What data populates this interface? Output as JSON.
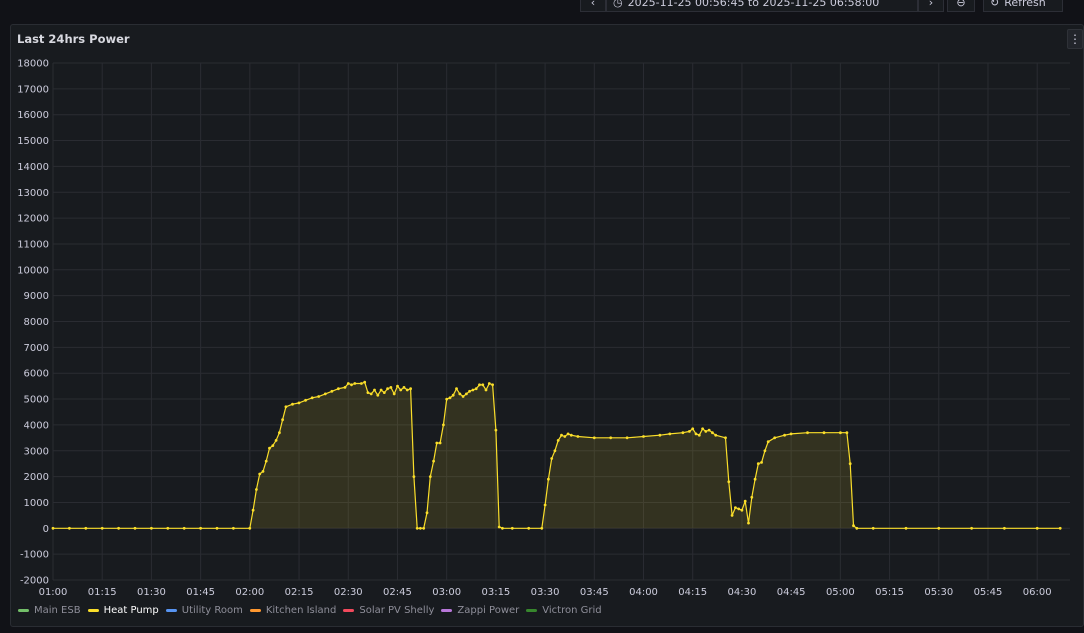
{
  "toolbar": {
    "back_icon": "chevron-left-icon",
    "time_range_text": "2025-11-25 00:56:45 to 2025-11-25 06:58:00",
    "forward_icon": "chevron-right-icon",
    "zoom_icon": "zoom-out-icon",
    "refresh_label": "Refresh"
  },
  "panel": {
    "title": "Last 24hrs Power",
    "menu_icon": "more-vertical-icon"
  },
  "chart_data": {
    "type": "line",
    "title": "Last 24hrs Power",
    "xlabel": "",
    "ylabel": "",
    "x_range": [
      "01:00",
      "06:10"
    ],
    "ylim": [
      -2000,
      18000
    ],
    "y_ticks": [
      18000,
      17000,
      16000,
      15000,
      14000,
      13000,
      12000,
      11000,
      10000,
      9000,
      8000,
      7000,
      6000,
      5000,
      4000,
      3000,
      2000,
      1000,
      0,
      -1000,
      -2000
    ],
    "x_ticks": [
      "01:00",
      "01:15",
      "01:30",
      "01:45",
      "02:00",
      "02:15",
      "02:30",
      "02:45",
      "03:00",
      "03:15",
      "03:30",
      "03:45",
      "04:00",
      "04:15",
      "04:30",
      "04:45",
      "05:00",
      "05:15",
      "05:30",
      "05:45",
      "06:00"
    ],
    "grid": true,
    "legend_position": "bottom-left",
    "series": [
      {
        "name": "Main ESB",
        "color": "#73bf69",
        "visible": false,
        "points": []
      },
      {
        "name": "Heat Pump",
        "color": "#fade2a",
        "visible": true,
        "points": [
          [
            "01:00",
            0
          ],
          [
            "01:05",
            0
          ],
          [
            "01:10",
            0
          ],
          [
            "01:15",
            0
          ],
          [
            "01:20",
            0
          ],
          [
            "01:25",
            0
          ],
          [
            "01:30",
            0
          ],
          [
            "01:35",
            0
          ],
          [
            "01:40",
            0
          ],
          [
            "01:45",
            0
          ],
          [
            "01:50",
            0
          ],
          [
            "01:55",
            0
          ],
          [
            "02:00",
            0
          ],
          [
            "02:01",
            700
          ],
          [
            "02:02",
            1500
          ],
          [
            "02:03",
            2100
          ],
          [
            "02:04",
            2200
          ],
          [
            "02:05",
            2600
          ],
          [
            "02:06",
            3100
          ],
          [
            "02:07",
            3200
          ],
          [
            "02:08",
            3400
          ],
          [
            "02:09",
            3700
          ],
          [
            "02:10",
            4200
          ],
          [
            "02:11",
            4700
          ],
          [
            "02:13",
            4800
          ],
          [
            "02:15",
            4850
          ],
          [
            "02:17",
            4950
          ],
          [
            "02:19",
            5050
          ],
          [
            "02:21",
            5100
          ],
          [
            "02:23",
            5200
          ],
          [
            "02:25",
            5300
          ],
          [
            "02:27",
            5400
          ],
          [
            "02:29",
            5450
          ],
          [
            "02:30",
            5600
          ],
          [
            "02:31",
            5550
          ],
          [
            "02:32",
            5600
          ],
          [
            "02:34",
            5600
          ],
          [
            "02:35",
            5650
          ],
          [
            "02:36",
            5250
          ],
          [
            "02:37",
            5200
          ],
          [
            "02:38",
            5350
          ],
          [
            "02:39",
            5150
          ],
          [
            "02:40",
            5350
          ],
          [
            "02:41",
            5250
          ],
          [
            "02:42",
            5400
          ],
          [
            "02:43",
            5450
          ],
          [
            "02:44",
            5200
          ],
          [
            "02:45",
            5500
          ],
          [
            "02:46",
            5350
          ],
          [
            "02:47",
            5450
          ],
          [
            "02:48",
            5350
          ],
          [
            "02:49",
            5400
          ],
          [
            "02:50",
            2000
          ],
          [
            "02:51",
            0
          ],
          [
            "02:52",
            0
          ],
          [
            "02:53",
            0
          ],
          [
            "02:54",
            600
          ],
          [
            "02:55",
            2000
          ],
          [
            "02:56",
            2600
          ],
          [
            "02:57",
            3300
          ],
          [
            "02:58",
            3300
          ],
          [
            "02:59",
            4000
          ],
          [
            "03:00",
            5000
          ],
          [
            "03:01",
            5050
          ],
          [
            "03:02",
            5150
          ],
          [
            "03:03",
            5400
          ],
          [
            "03:04",
            5200
          ],
          [
            "03:05",
            5100
          ],
          [
            "03:06",
            5200
          ],
          [
            "03:07",
            5300
          ],
          [
            "03:08",
            5350
          ],
          [
            "03:09",
            5400
          ],
          [
            "03:10",
            5550
          ],
          [
            "03:11",
            5550
          ],
          [
            "03:12",
            5350
          ],
          [
            "03:13",
            5600
          ],
          [
            "03:14",
            5550
          ],
          [
            "03:15",
            3800
          ],
          [
            "03:16",
            50
          ],
          [
            "03:17",
            0
          ],
          [
            "03:20",
            0
          ],
          [
            "03:25",
            0
          ],
          [
            "03:29",
            0
          ],
          [
            "03:30",
            900
          ],
          [
            "03:31",
            1900
          ],
          [
            "03:32",
            2700
          ],
          [
            "03:33",
            3000
          ],
          [
            "03:34",
            3400
          ],
          [
            "03:35",
            3600
          ],
          [
            "03:36",
            3550
          ],
          [
            "03:37",
            3650
          ],
          [
            "03:38",
            3600
          ],
          [
            "03:40",
            3550
          ],
          [
            "03:45",
            3500
          ],
          [
            "03:50",
            3500
          ],
          [
            "03:55",
            3500
          ],
          [
            "04:00",
            3550
          ],
          [
            "04:05",
            3600
          ],
          [
            "04:08",
            3650
          ],
          [
            "04:12",
            3700
          ],
          [
            "04:14",
            3750
          ],
          [
            "04:15",
            3850
          ],
          [
            "04:16",
            3650
          ],
          [
            "04:17",
            3600
          ],
          [
            "04:18",
            3850
          ],
          [
            "04:19",
            3750
          ],
          [
            "04:20",
            3800
          ],
          [
            "04:21",
            3700
          ],
          [
            "04:22",
            3600
          ],
          [
            "04:25",
            3500
          ],
          [
            "04:26",
            1800
          ],
          [
            "04:27",
            500
          ],
          [
            "04:28",
            800
          ],
          [
            "04:29",
            750
          ],
          [
            "04:30",
            700
          ],
          [
            "04:31",
            1050
          ],
          [
            "04:32",
            200
          ],
          [
            "04:33",
            1200
          ],
          [
            "04:34",
            1900
          ],
          [
            "04:35",
            2500
          ],
          [
            "04:36",
            2550
          ],
          [
            "04:37",
            3000
          ],
          [
            "04:38",
            3350
          ],
          [
            "04:40",
            3500
          ],
          [
            "04:43",
            3600
          ],
          [
            "04:45",
            3650
          ],
          [
            "04:50",
            3700
          ],
          [
            "04:55",
            3700
          ],
          [
            "05:00",
            3700
          ],
          [
            "05:02",
            3700
          ],
          [
            "05:03",
            2500
          ],
          [
            "05:04",
            100
          ],
          [
            "05:05",
            0
          ],
          [
            "05:10",
            0
          ],
          [
            "05:20",
            0
          ],
          [
            "05:30",
            0
          ],
          [
            "05:40",
            0
          ],
          [
            "05:50",
            0
          ],
          [
            "06:00",
            0
          ],
          [
            "06:07",
            0
          ]
        ]
      },
      {
        "name": "Utility Room",
        "color": "#5794f2",
        "visible": false,
        "points": []
      },
      {
        "name": "Kitchen Island",
        "color": "#ff9830",
        "visible": false,
        "points": []
      },
      {
        "name": "Solar PV Shelly",
        "color": "#f2495c",
        "visible": false,
        "points": []
      },
      {
        "name": "Zappi Power",
        "color": "#b877d9",
        "visible": false,
        "points": []
      },
      {
        "name": "Victron Grid",
        "color": "#37872d",
        "visible": false,
        "points": []
      }
    ]
  },
  "legend": [
    {
      "label": "Main ESB",
      "color": "#73bf69",
      "active": false
    },
    {
      "label": "Heat Pump",
      "color": "#fade2a",
      "active": true
    },
    {
      "label": "Utility Room",
      "color": "#5794f2",
      "active": false
    },
    {
      "label": "Kitchen Island",
      "color": "#ff9830",
      "active": false
    },
    {
      "label": "Solar PV Shelly",
      "color": "#f2495c",
      "active": false
    },
    {
      "label": "Zappi Power",
      "color": "#b877d9",
      "active": false
    },
    {
      "label": "Victron Grid",
      "color": "#37872d",
      "active": false
    }
  ]
}
